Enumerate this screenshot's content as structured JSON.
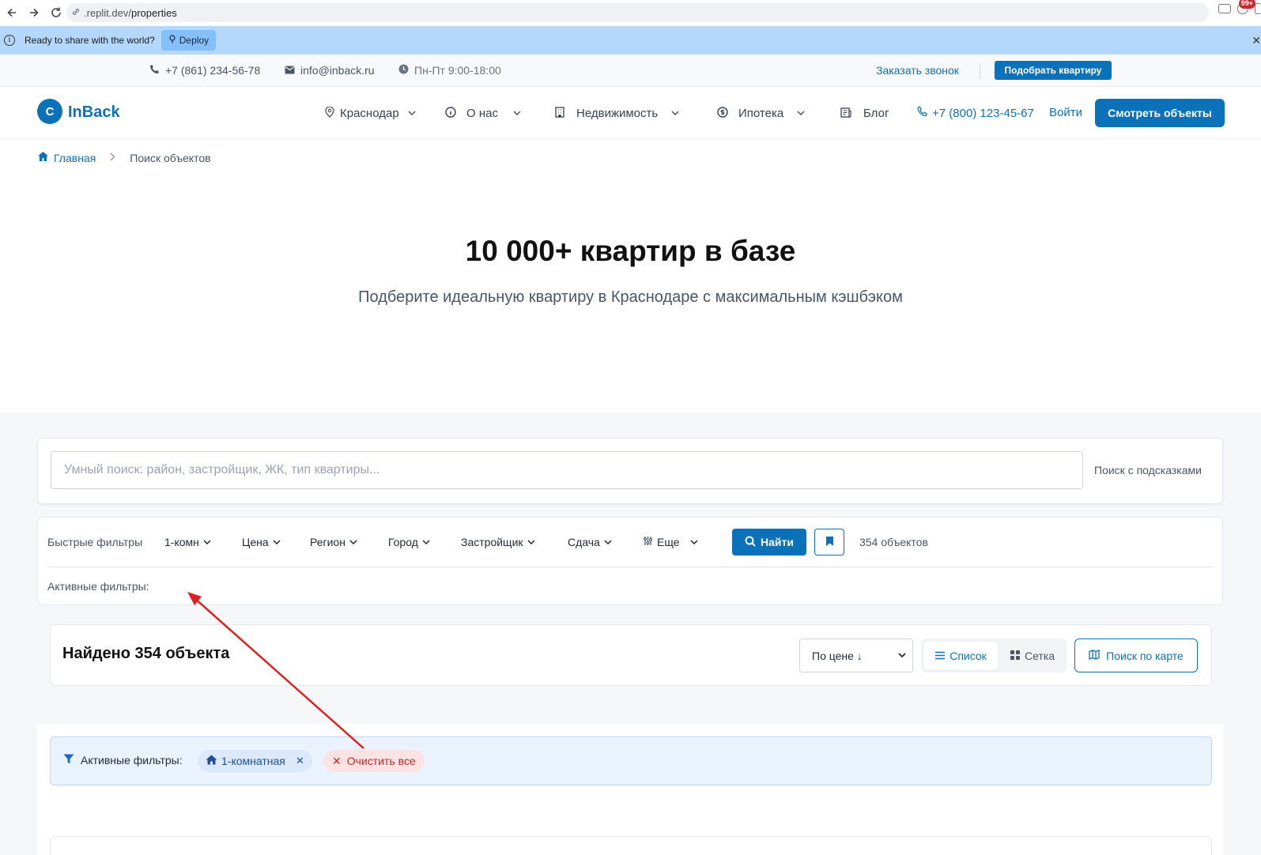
{
  "browser": {
    "url_prefix": ".replit.dev/",
    "url_path": "properties",
    "ext_badge": "99+"
  },
  "banner": {
    "text": "Ready to share with the world?",
    "deploy_label": "Deploy"
  },
  "topbar": {
    "phone": "+7 (861) 234-56-78",
    "email": "info@inback.ru",
    "hours": "Пн-Пт 9:00-18:00",
    "callback": "Заказать звонок",
    "pick_button": "Подобрать квартиру"
  },
  "header": {
    "logo_letter": "C",
    "logo_text": "InBack",
    "nav": {
      "city": "Краснодар",
      "about": "О нас",
      "realty": "Недвижимость",
      "mortgage": "Ипотека",
      "blog": "Блог"
    },
    "phone": "+7 (800) 123-45-67",
    "login": "Войти",
    "view_button": "Смотреть объекты"
  },
  "breadcrumb": {
    "home": "Главная",
    "current": "Поиск объектов"
  },
  "hero": {
    "title": "10 000+ квартир в базе",
    "subtitle": "Подберите идеальную квартиру в Краснодаре с максимальным кэшбэком"
  },
  "search": {
    "placeholder": "Умный поиск: район, застройщик, ЖК, тип квартиры...",
    "hint": "Поиск с подсказками"
  },
  "filters": {
    "label": "Быстрые фильтры",
    "rooms": "1-комн",
    "price": "Цена",
    "region": "Регион",
    "city": "Город",
    "developer": "Застройщик",
    "delivery": "Сдача",
    "more": "Еще",
    "find_button": "Найти",
    "count": "354 объектов",
    "active_label": "Активные фильтры:"
  },
  "results": {
    "title": "Найдено 354 объекта",
    "sort_value": "По цене ↓",
    "view_list": "Список",
    "view_grid": "Сетка",
    "map_button": "Поиск по карте"
  },
  "active_filters": {
    "label": "Активные фильтры:",
    "chip_room": "1-комнатная",
    "clear_all": "Очистить все"
  },
  "colors": {
    "brand": "#0b72b9",
    "annotation_arrow": "#e02020"
  },
  "icons": [
    "back-icon",
    "forward-icon",
    "reload-icon",
    "link-icon",
    "info-icon",
    "phone-icon",
    "mail-icon",
    "clock-icon",
    "map-pin-icon",
    "home-icon",
    "building-icon",
    "dollar-icon",
    "blog-icon",
    "search-icon",
    "bookmark-icon",
    "sliders-icon",
    "list-icon",
    "grid-icon",
    "map-icon",
    "filter-icon",
    "close-icon"
  ]
}
